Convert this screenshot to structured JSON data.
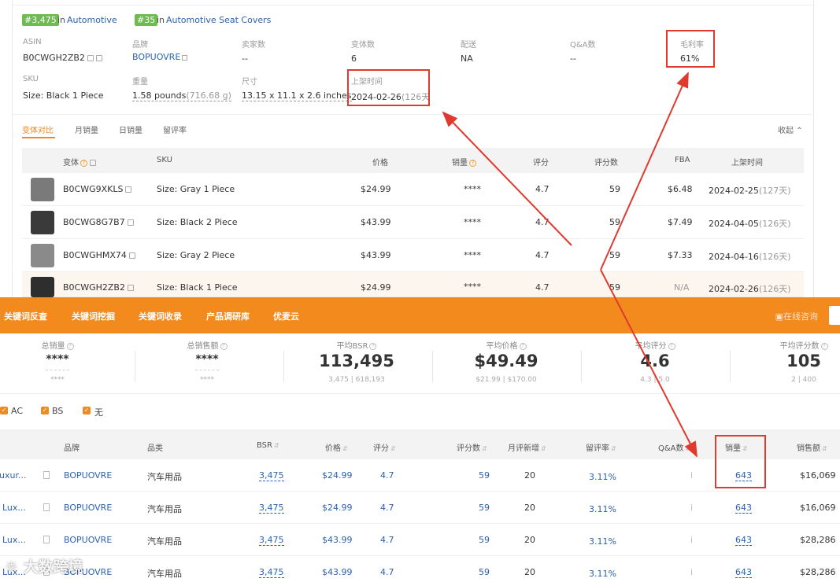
{
  "ranks": [
    {
      "badge": "#3,475",
      "in": "in",
      "category": "Automotive"
    },
    {
      "badge": "#35",
      "in": "in",
      "category": "Automotive Seat Covers"
    }
  ],
  "product_meta": {
    "asin": {
      "label": "ASIN",
      "value": "B0CWGH2ZB2"
    },
    "brand": {
      "label": "品牌",
      "value": "BOPUOVRE"
    },
    "sellers": {
      "label": "卖家数",
      "value": "--"
    },
    "variants": {
      "label": "变体数",
      "value": "6"
    },
    "delivery": {
      "label": "配送",
      "value": "NA"
    },
    "qa": {
      "label": "Q&A数",
      "value": "--"
    },
    "margin": {
      "label": "毛利率",
      "value": "61%"
    },
    "sku": {
      "label": "SKU",
      "value": "Size: Black 1 Piece"
    },
    "weight": {
      "label": "重量",
      "value": "1.58 pounds",
      "sub": "(716.68 g)"
    },
    "dimensions": {
      "label": "尺寸",
      "value": "13.15 x 11.1 x 2.6 inches"
    },
    "listed": {
      "label": "上架时间",
      "value": "2024-02-26",
      "sub": "(126天"
    }
  },
  "tabs": [
    "变体对比",
    "月销量",
    "日销量",
    "留评率"
  ],
  "collapse_label": "收起",
  "variant_table": {
    "headers": [
      "变体",
      "SKU",
      "价格",
      "销量",
      "评分",
      "评分数",
      "FBA",
      "上架时间"
    ],
    "rows": [
      {
        "asin": "B0CWG9XKLS",
        "sku": "Size: Gray 1 Piece",
        "price": "$24.99",
        "sales": "****",
        "rating": "4.7",
        "count": "59",
        "fba": "$6.48",
        "date": "2024-02-25",
        "days": "(127天)",
        "thumb": "#7a7a7a"
      },
      {
        "asin": "B0CWG8G7B7",
        "sku": "Size: Black 2 Piece",
        "price": "$43.99",
        "sales": "****",
        "rating": "4.7",
        "count": "59",
        "fba": "$7.49",
        "date": "2024-04-05",
        "days": "(126天)",
        "thumb": "#3a3a3a"
      },
      {
        "asin": "B0CWGHMX74",
        "sku": "Size: Gray 2 Piece",
        "price": "$43.99",
        "sales": "****",
        "rating": "4.7",
        "count": "59",
        "fba": "$7.33",
        "date": "2024-04-16",
        "days": "(126天)",
        "thumb": "#8a8a8a"
      },
      {
        "asin": "B0CWGH2ZB2",
        "sku": "Size: Black 1 Piece",
        "price": "$24.99",
        "sales": "****",
        "rating": "4.7",
        "count": "59",
        "fba": "N/A",
        "date": "2024-02-26",
        "days": "(126天)",
        "thumb": "#2e2e2e"
      }
    ]
  },
  "toolbar": {
    "items": [
      "关键词反查",
      "关键词挖掘",
      "关键词收录",
      "产品调研库",
      "优麦云"
    ],
    "consult": "在线咨询",
    "color": "#f28a1d"
  },
  "stats": [
    {
      "label": "总销量",
      "value": "****",
      "sub": "****"
    },
    {
      "label": "总销售额",
      "value": "****",
      "sub": "****"
    },
    {
      "label": "平均BSR",
      "value": "113,495",
      "sub": "3,475 | 618,193"
    },
    {
      "label": "平均价格",
      "value": "$49.49",
      "sub": "$21.99 | $170.00"
    },
    {
      "label": "平均评分",
      "value": "4.6",
      "sub": "4.3 | 5.0"
    },
    {
      "label": "平均评分数",
      "value": "105",
      "sub": "2 | 400"
    }
  ],
  "filters": [
    "AC",
    "BS",
    "无"
  ],
  "product_table": {
    "headers": [
      "品牌",
      "品类",
      "BSR",
      "价格",
      "评分",
      "评分数",
      "月评新增",
      "留评率",
      "Q&A数",
      "销量",
      "销售额"
    ],
    "rows": [
      {
        "title": "uxur...",
        "brand": "BOPUOVRE",
        "category": "汽车用品",
        "bsr": "3,475",
        "price": "$24.99",
        "rating": "4.7",
        "count": "59",
        "new": "20",
        "review_rate": "3.11%",
        "qa": "i",
        "sales": "643",
        "revenue": "$16,069"
      },
      {
        "title": "Lux...",
        "brand": "BOPUOVRE",
        "category": "汽车用品",
        "bsr": "3,475",
        "price": "$24.99",
        "rating": "4.7",
        "count": "59",
        "new": "20",
        "review_rate": "3.11%",
        "qa": "i",
        "sales": "643",
        "revenue": "$16,069"
      },
      {
        "title": "Lux...",
        "brand": "BOPUOVRE",
        "category": "汽车用品",
        "bsr": "3,475",
        "price": "$43.99",
        "rating": "4.7",
        "count": "59",
        "new": "20",
        "review_rate": "3.11%",
        "qa": "i",
        "sales": "643",
        "revenue": "$28,286"
      },
      {
        "title": "Lux...",
        "brand": "BOPUOVRE",
        "category": "汽车用品",
        "bsr": "3,475",
        "price": "$43.99",
        "rating": "4.7",
        "count": "59",
        "new": "20",
        "review_rate": "3.11%",
        "qa": "i",
        "sales": "643",
        "revenue": "$28,286"
      }
    ]
  },
  "watermark": "大数跨境",
  "colors": {
    "accent": "#f0871f",
    "link": "#2a62b0",
    "annotation": "#e03a2e",
    "rank_badge": "#6fbb4f"
  }
}
